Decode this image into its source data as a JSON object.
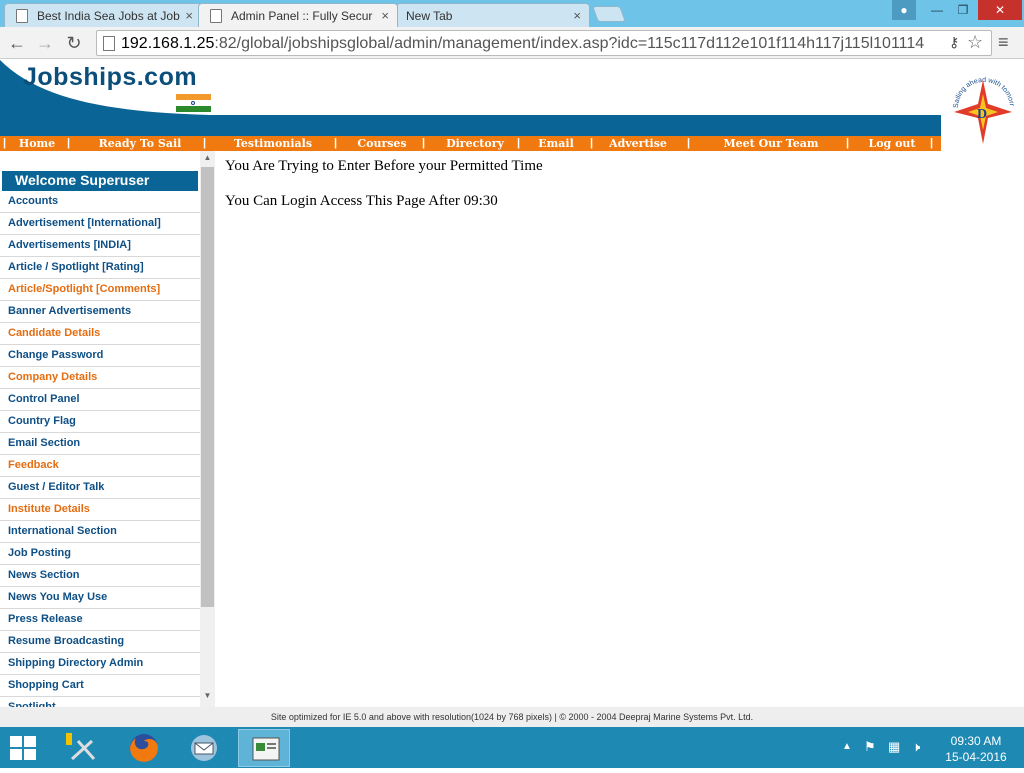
{
  "browser": {
    "tabs": [
      {
        "title": "Best India Sea Jobs at Job",
        "close": "×"
      },
      {
        "title": "Admin Panel :: Fully Secur",
        "close": "×"
      },
      {
        "title": "New Tab",
        "close": "×"
      }
    ],
    "url_host": "192.168.1.25",
    "url_path": ":82/global/jobshipsglobal/admin/management/index.asp?idc=115c117d112e101f114h117j115l101114"
  },
  "site": {
    "logo": "Jobships.com",
    "seal_text": "Sailing ahead with tomorrow",
    "nav": [
      "Home",
      "Ready To Sail",
      "Testimonials",
      "Courses",
      "Directory",
      "Email",
      "Advertise",
      "Meet Our Team",
      "Log out"
    ]
  },
  "sidebar": {
    "welcome": "Welcome Superuser",
    "items": [
      {
        "label": "Accounts",
        "orange": false
      },
      {
        "label": "Advertisement [International]",
        "orange": false
      },
      {
        "label": "Advertisements [INDIA]",
        "orange": false
      },
      {
        "label": "Article / Spotlight [Rating]",
        "orange": false
      },
      {
        "label": "Article/Spotlight [Comments]",
        "orange": true
      },
      {
        "label": "Banner Advertisements",
        "orange": false
      },
      {
        "label": "Candidate Details",
        "orange": true
      },
      {
        "label": "Change Password",
        "orange": false
      },
      {
        "label": "Company Details",
        "orange": true
      },
      {
        "label": "Control Panel",
        "orange": false
      },
      {
        "label": "Country Flag",
        "orange": false
      },
      {
        "label": "Email Section",
        "orange": false
      },
      {
        "label": "Feedback",
        "orange": true
      },
      {
        "label": "Guest / Editor Talk",
        "orange": false
      },
      {
        "label": "Institute Details",
        "orange": true
      },
      {
        "label": "International Section",
        "orange": false
      },
      {
        "label": "Job Posting",
        "orange": false
      },
      {
        "label": "News Section",
        "orange": false
      },
      {
        "label": "News You May Use",
        "orange": false
      },
      {
        "label": "Press Release",
        "orange": false
      },
      {
        "label": "Resume Broadcasting",
        "orange": false
      },
      {
        "label": "Shipping Directory Admin",
        "orange": false
      },
      {
        "label": "Shopping Cart",
        "orange": false
      },
      {
        "label": "Spotlight",
        "orange": false
      }
    ]
  },
  "content": {
    "line1": "You Are Trying to Enter Before your Permitted Time",
    "line2": "You Can Login Access This Page After 09:30"
  },
  "footer": "Site optimized for IE 5.0 and above with resolution(1024 by 768 pixels) | © 2000 - 2004 Deepraj Marine Systems Pvt. Ltd.",
  "taskbar": {
    "time": "09:30 AM",
    "date": "15-04-2016"
  },
  "colors": {
    "nav_orange": "#f07a10",
    "brand_blue": "#0a6596",
    "link_blue": "#0e4f85",
    "link_orange": "#e46d12"
  }
}
